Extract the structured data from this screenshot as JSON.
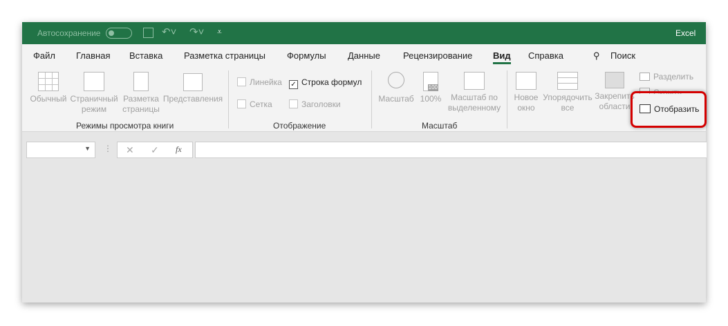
{
  "title": {
    "autosave": "Автосохранение",
    "app": "Excel"
  },
  "tabs": [
    "Файл",
    "Главная",
    "Вставка",
    "Разметка страницы",
    "Формулы",
    "Данные",
    "Рецензирование",
    "Вид",
    "Справка"
  ],
  "search": "Поиск",
  "views": {
    "normal": "Обычный",
    "page_break_1": "Страничный",
    "page_break_2": "режим",
    "layout_1": "Разметка",
    "layout_2": "страницы",
    "custom": "Представления",
    "group": "Режимы просмотра книги"
  },
  "show": {
    "ruler": "Линейка",
    "formula_bar": "Строка формул",
    "gridlines": "Сетка",
    "headings": "Заголовки",
    "group": "Отображение",
    "formula_checked": true
  },
  "zoom": {
    "zoom": "Масштаб",
    "pct": "100%",
    "sel_1": "Масштаб по",
    "sel_2": "выделенному",
    "group": "Масштаб",
    "icon_text": "100"
  },
  "window": {
    "new_1": "Новое",
    "new_2": "окно",
    "arrange_1": "Упорядочить",
    "arrange_2": "все",
    "freeze_1": "Закрепить",
    "freeze_2": "области",
    "split": "Разделить",
    "hide": "Скрыть",
    "unhide": "Отобразить"
  },
  "formula": {
    "fx": "fx"
  },
  "colors": {
    "brand": "#217346",
    "highlight": "#d40000"
  }
}
